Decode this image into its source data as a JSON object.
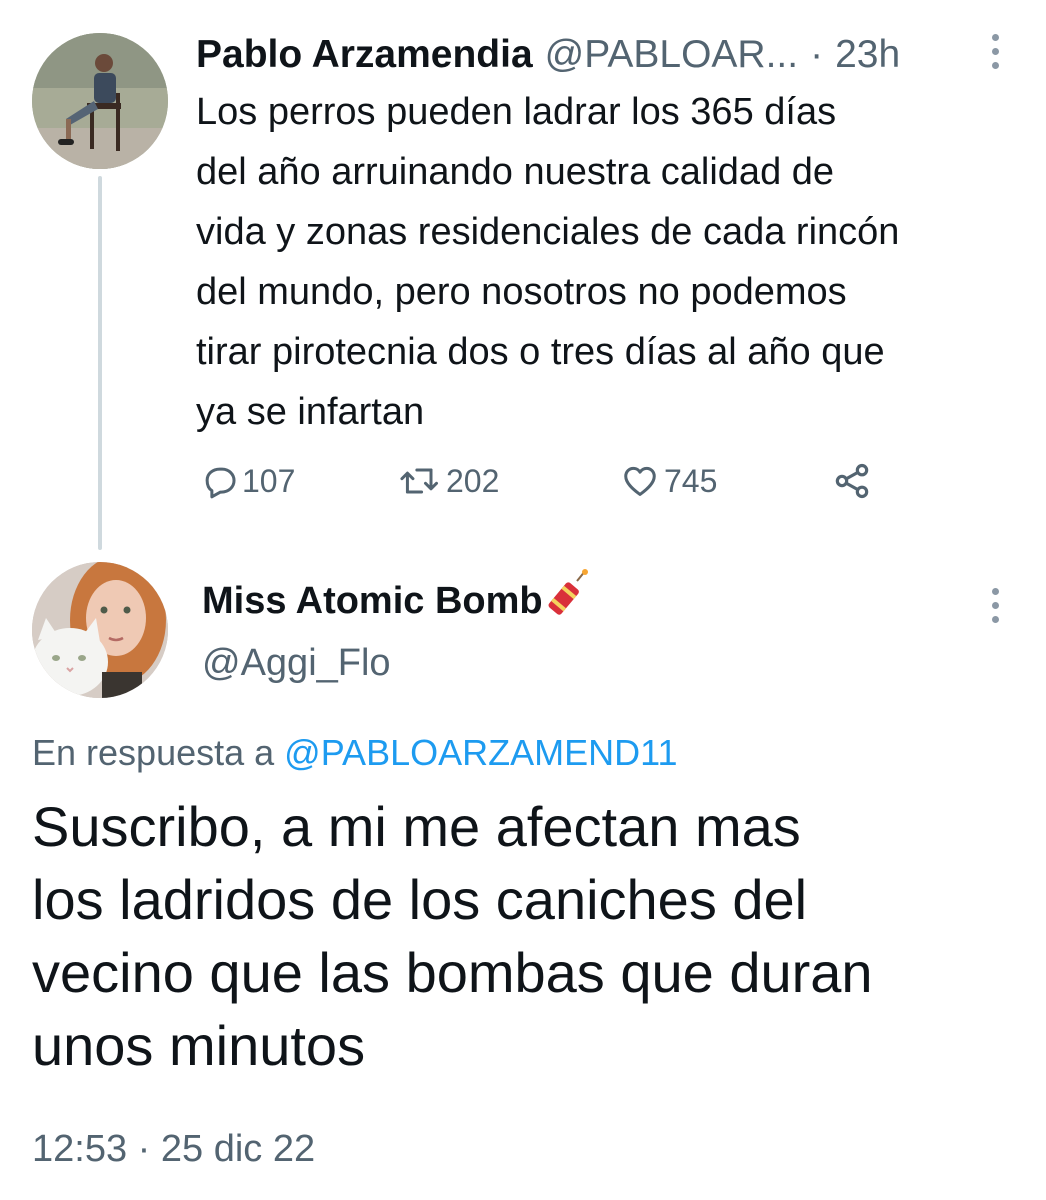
{
  "parent_tweet": {
    "author_name": "Pablo Arzamendia",
    "handle": "@PABLOAR...",
    "separator": "·",
    "time": "23h",
    "text": "Los perros pueden ladrar los 365 días\ndel año arruinando nuestra calidad de\nvida y zonas residenciales de cada rincón\ndel mundo, pero nosotros no podemos\ntirar pirotecnia dos o tres días al año que\nya se infartan",
    "replies": "107",
    "retweets": "202",
    "likes": "745"
  },
  "reply_tweet": {
    "author_name": "Miss Atomic Bomb",
    "name_emoji": "firecracker",
    "handle": "@Aggi_Flo",
    "in_reply_prefix": "En respuesta a",
    "in_reply_handle": "@PABLOARZAMEND11",
    "text": "Suscribo, a mi me afectan mas\nlos ladridos de los caniches del\nvecino que las bombas que duran\nunos minutos",
    "time": "12:53",
    "separator": "·",
    "date": "25 dic 22"
  },
  "colors": {
    "text_primary": "#0f1419",
    "text_secondary": "#536471",
    "link": "#1d9bf0",
    "thread_line": "#cfd9de"
  },
  "icons": [
    "reply-icon",
    "retweet-icon",
    "like-icon",
    "share-icon",
    "more-icon",
    "firecracker-icon"
  ]
}
